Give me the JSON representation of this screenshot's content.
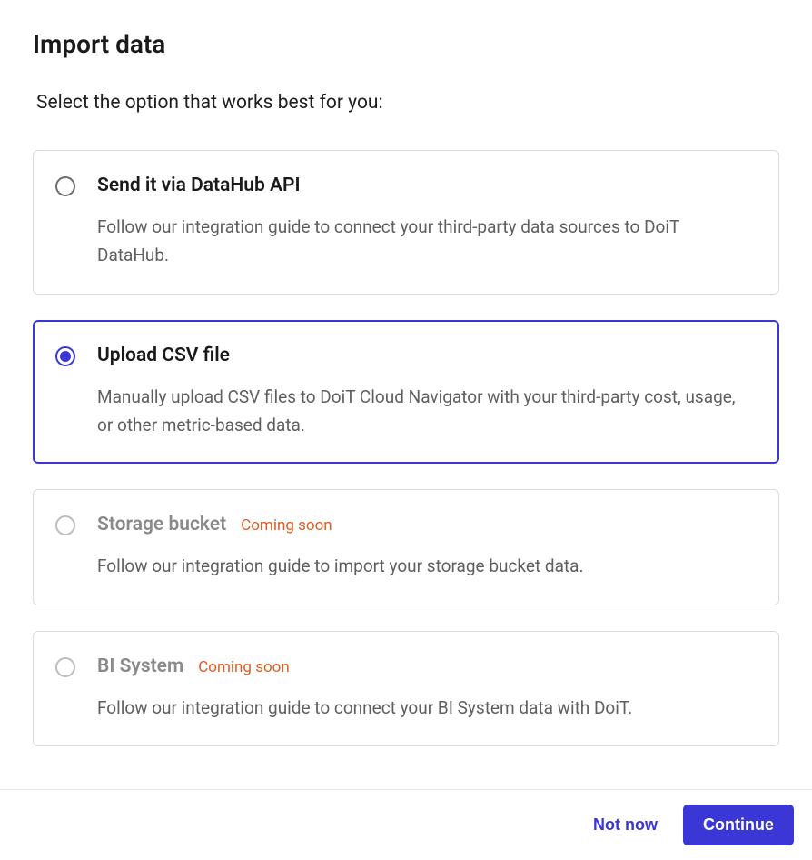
{
  "page": {
    "title": "Import data",
    "subtitle": "Select the option that works best for you:"
  },
  "options": [
    {
      "title": "Send it via DataHub API",
      "description": "Follow our integration guide to connect your third-party data sources to DoiT DataHub.",
      "selected": false,
      "disabled": false,
      "badge": null
    },
    {
      "title": "Upload CSV file",
      "description": "Manually upload CSV files to DoiT Cloud Navigator with your third-party cost, usage, or other metric-based data.",
      "selected": true,
      "disabled": false,
      "badge": null
    },
    {
      "title": "Storage bucket",
      "description": "Follow our integration guide to import your storage bucket data.",
      "selected": false,
      "disabled": true,
      "badge": "Coming soon"
    },
    {
      "title": "BI System",
      "description": "Follow our integration guide to connect your BI System data with DoiT.",
      "selected": false,
      "disabled": true,
      "badge": "Coming soon"
    }
  ],
  "footer": {
    "not_now_label": "Not now",
    "continue_label": "Continue"
  }
}
